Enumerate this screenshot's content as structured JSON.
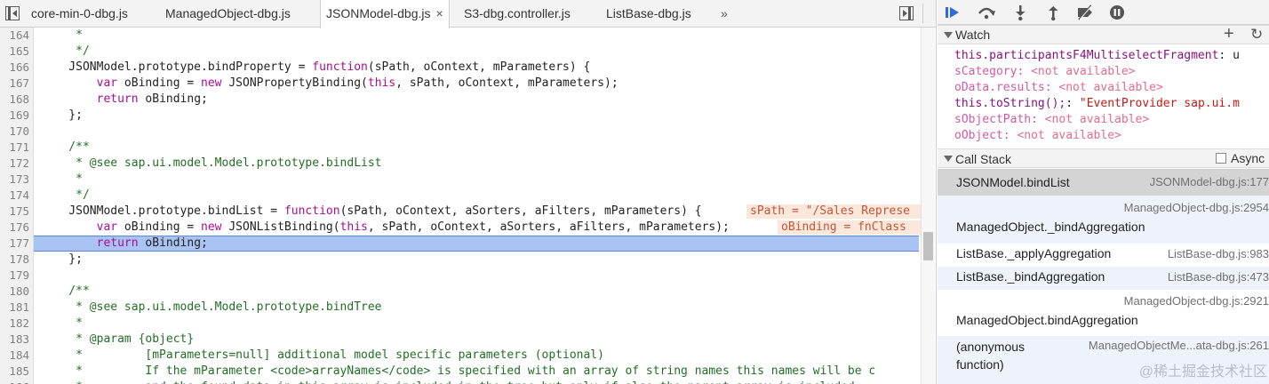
{
  "tabs": [
    {
      "label": "core-min-0-dbg.js"
    },
    {
      "label": "ManagedObject-dbg.js"
    },
    {
      "label": "JSONModel-dbg.js",
      "active": true
    },
    {
      "label": "S3-dbg.controller.js"
    },
    {
      "label": "ListBase-dbg.js"
    }
  ],
  "tab_close_glyph": "×",
  "more_tabs_glyph": "»",
  "code_lines": [
    {
      "n": "164",
      "segs": [
        {
          "t": "     *",
          "c": "c"
        }
      ]
    },
    {
      "n": "165",
      "segs": [
        {
          "t": "     */",
          "c": "c"
        }
      ]
    },
    {
      "n": "166",
      "segs": [
        {
          "t": "    JSONModel.prototype.bindProperty = "
        },
        {
          "t": "function",
          "c": "k"
        },
        {
          "t": "(sPath, oContext, mParameters) {"
        }
      ]
    },
    {
      "n": "167",
      "segs": [
        {
          "t": "        "
        },
        {
          "t": "var",
          "c": "k"
        },
        {
          "t": " oBinding = "
        },
        {
          "t": "new",
          "c": "k"
        },
        {
          "t": " JSONPropertyBinding("
        },
        {
          "t": "this",
          "c": "k"
        },
        {
          "t": ", sPath, oContext, mParameters);"
        }
      ]
    },
    {
      "n": "168",
      "segs": [
        {
          "t": "        "
        },
        {
          "t": "return",
          "c": "k"
        },
        {
          "t": " oBinding;"
        }
      ]
    },
    {
      "n": "169",
      "segs": [
        {
          "t": "    };"
        }
      ]
    },
    {
      "n": "170",
      "segs": []
    },
    {
      "n": "171",
      "segs": [
        {
          "t": "    /**",
          "c": "c"
        }
      ]
    },
    {
      "n": "172",
      "segs": [
        {
          "t": "     * @see sap.ui.model.Model.prototype.bindList",
          "c": "c"
        }
      ]
    },
    {
      "n": "173",
      "segs": [
        {
          "t": "     *",
          "c": "c"
        }
      ]
    },
    {
      "n": "174",
      "segs": [
        {
          "t": "     */",
          "c": "c"
        }
      ]
    },
    {
      "n": "175",
      "segs": [
        {
          "t": "    JSONModel.prototype.bindList = "
        },
        {
          "t": "function",
          "c": "k"
        },
        {
          "t": "(sPath, oContext, aSorters, aFilters, mParameters) {"
        }
      ],
      "inline": "sPath = \"/Sales Represe",
      "inline_color": "#fbe8db",
      "inline_fg": "#c0553a"
    },
    {
      "n": "176",
      "segs": [
        {
          "t": "        "
        },
        {
          "t": "var",
          "c": "k"
        },
        {
          "t": " oBinding = "
        },
        {
          "t": "new",
          "c": "k"
        },
        {
          "t": " JSONListBinding("
        },
        {
          "t": "this",
          "c": "k"
        },
        {
          "t": ", sPath, oContext, aSorters, aFilters, mParameters);"
        }
      ],
      "inline": "oBinding = fnClass",
      "inline_color": "#fbe8db",
      "inline_fg": "#c0553a"
    },
    {
      "n": "177",
      "segs": [
        {
          "t": "        "
        },
        {
          "t": "return",
          "c": "k"
        },
        {
          "t": " oBinding;"
        }
      ],
      "highlight": true
    },
    {
      "n": "178",
      "segs": [
        {
          "t": "    };"
        }
      ]
    },
    {
      "n": "179",
      "segs": []
    },
    {
      "n": "180",
      "segs": [
        {
          "t": "    /**",
          "c": "c"
        }
      ]
    },
    {
      "n": "181",
      "segs": [
        {
          "t": "     * @see sap.ui.model.Model.prototype.bindTree",
          "c": "c"
        }
      ]
    },
    {
      "n": "182",
      "segs": [
        {
          "t": "     *",
          "c": "c"
        }
      ]
    },
    {
      "n": "183",
      "segs": [
        {
          "t": "     * @param {object}",
          "c": "c"
        }
      ]
    },
    {
      "n": "184",
      "segs": [
        {
          "t": "     *         [mParameters=null] additional model specific parameters (optional)",
          "c": "c"
        }
      ]
    },
    {
      "n": "185",
      "segs": [
        {
          "t": "     *         If the mParameter <code>arrayNames</code> is specified with an array of string names this names will be c",
          "c": "c"
        }
      ]
    },
    {
      "n": "186",
      "segs": [
        {
          "t": "     *         and the found data in this array is included in the tree but only if also the parent array is included",
          "c": "c"
        }
      ]
    }
  ],
  "sidebar": {
    "watch": {
      "title": "Watch",
      "add_glyph": "+",
      "refresh_glyph": "↻",
      "items": [
        {
          "name": "this.participantsF4MultiselectFragment",
          "sep": ": ",
          "value": "u",
          "na": false,
          "plain": true
        },
        {
          "name": "sCategory",
          "sep": ": ",
          "value": "<not available>",
          "na": true
        },
        {
          "name": "oData.results",
          "sep": ": ",
          "value": "<not available>",
          "na": true
        },
        {
          "name": "this.toString();",
          "sep": ": ",
          "value": "\"EventProvider sap.ui.m",
          "na": false
        },
        {
          "name": "sObjectPath",
          "sep": ": ",
          "value": "<not available>",
          "na": true
        },
        {
          "name": "oObject",
          "sep": ": ",
          "value": "<not available>",
          "na": true
        }
      ]
    },
    "callstack": {
      "title": "Call Stack",
      "async_label": "Async",
      "frames": [
        {
          "name": "JSONModel.bindList",
          "loc": "JSONModel-dbg.js:177",
          "selected": true,
          "twoline": false
        },
        {
          "name": "ManagedObject._bindAggregation",
          "loc": "ManagedObject-dbg.js:2954",
          "twoline": true
        },
        {
          "name": "ListBase._applyAggregation",
          "loc": "ListBase-dbg.js:983",
          "twoline": false
        },
        {
          "name": "ListBase._bindAggregation",
          "loc": "ListBase-dbg.js:473",
          "twoline": false
        },
        {
          "name": "ManagedObject.bindAggregation",
          "loc": "ManagedObject-dbg.js:2921",
          "twoline": true
        },
        {
          "name": "(anonymous\nfunction)",
          "loc": "ManagedObjectMe...ata-dbg.js:261",
          "twoline": "wrap"
        }
      ]
    }
  },
  "watermark": "@稀土掘金技术社区",
  "colors": {
    "highlight": "#a8c3f4",
    "accent": "#2f6ad8"
  }
}
